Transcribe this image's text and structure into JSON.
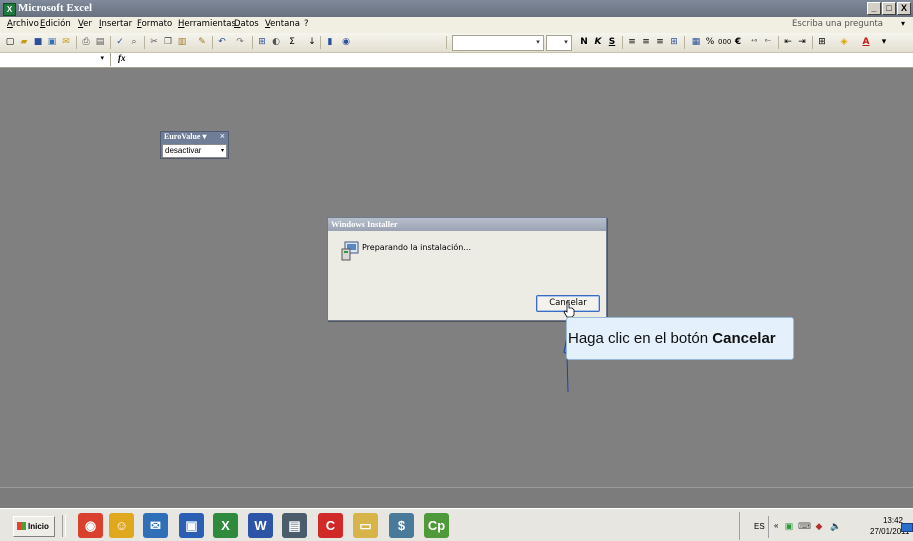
{
  "window": {
    "title": "Microsoft Excel",
    "app_icon": "excel-icon",
    "controls": [
      "_",
      "□",
      "X"
    ]
  },
  "menu": {
    "items": [
      "Archivo",
      "Edición",
      "Ver",
      "Insertar",
      "Formato",
      "Herramientas",
      "Datos",
      "Ventana",
      "?"
    ],
    "ask_placeholder": "Escriba una pregunta",
    "ask_arrow": "▾"
  },
  "toolbar": {
    "standard_icons": [
      "new-icon",
      "open-icon",
      "save-icon",
      "permission-icon",
      "email-icon",
      "print-icon",
      "print-preview-icon",
      "spelling-icon",
      "research-icon",
      "cut-icon",
      "copy-icon",
      "paste-icon",
      "format-painter-icon",
      "undo-icon",
      "redo-icon",
      "hyperlink-icon",
      "chart-wizard-icon",
      "autosum-icon",
      "sort-ascending-icon",
      "chart-icon",
      "help-icon"
    ],
    "bold": "N",
    "italic": "K",
    "underline": "S",
    "percent": "%",
    "thousands": "000",
    "euro": "€",
    "font_dropdown": "▾",
    "size_dropdown": "▾"
  },
  "formula_bar": {
    "fx_label": "fx",
    "namebox_arrow": "▾"
  },
  "eurovalue": {
    "title": "EuroValue",
    "title_arrow": "▾",
    "close": "×",
    "selected": "desactivar",
    "arrow": "▾"
  },
  "dialog": {
    "title": "Windows Installer",
    "message": "Preparando la instalación...",
    "cancel_label": "Cancelar"
  },
  "callout": {
    "prefix": "Haga clic en el botón ",
    "emphasis": "Cancelar"
  },
  "taskbar": {
    "start_label": "Inicio",
    "apps": [
      {
        "name": "chrome-icon",
        "glyph": "◉",
        "color": "#d9412e"
      },
      {
        "name": "contacts-icon",
        "glyph": "☺",
        "color": "#e0a81c"
      },
      {
        "name": "thunderbird-icon",
        "glyph": "✉",
        "color": "#2f6fb8"
      },
      {
        "name": "floppy-save-icon",
        "glyph": "▣",
        "color": "#2a5fb3"
      },
      {
        "name": "excel-icon",
        "glyph": "X",
        "color": "#2f8a3e"
      },
      {
        "name": "word-icon",
        "glyph": "W",
        "color": "#2c55a8"
      },
      {
        "name": "network-icon",
        "glyph": "▤",
        "color": "#4b5c6b"
      },
      {
        "name": "c-app-icon",
        "glyph": "C",
        "color": "#d12828"
      },
      {
        "name": "folder-icon",
        "glyph": "▭",
        "color": "#d6b44a"
      },
      {
        "name": "screen-recorder-icon",
        "glyph": "$",
        "color": "#4a7a9a"
      },
      {
        "name": "captivate-icon",
        "glyph": "Cp",
        "color": "#4e9a3a"
      }
    ],
    "language": "ES",
    "tray_chevron": "«",
    "time": "13:42",
    "date": "27/01/2011"
  },
  "colors": {
    "workspace_bg": "#808080",
    "callout_bg": "#e4f1fc",
    "titlebar": "#6c7585"
  }
}
